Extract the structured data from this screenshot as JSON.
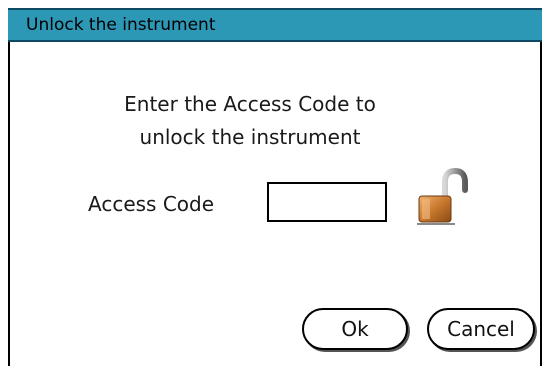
{
  "window": {
    "title": "Unlock the instrument"
  },
  "message": {
    "line1": "Enter the Access Code to",
    "line2": "unlock the instrument"
  },
  "access_code": {
    "label": "Access Code",
    "value": "",
    "placeholder": ""
  },
  "icons": {
    "lock": "unlocked-padlock-icon"
  },
  "buttons": {
    "ok_label": "Ok",
    "cancel_label": "Cancel"
  },
  "colors": {
    "titlebar": "#2d97b6",
    "lock_body": "#c8782e"
  }
}
